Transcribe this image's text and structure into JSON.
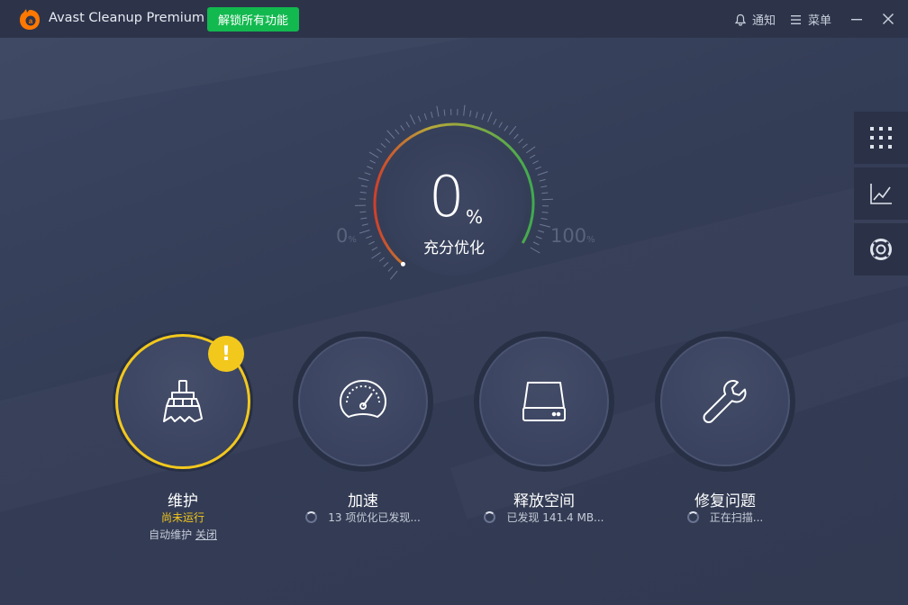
{
  "titlebar": {
    "app_name": "Avast Cleanup Premium",
    "unlock_label": "解锁所有功能",
    "notify_label": "通知",
    "menu_label": "菜单"
  },
  "gauge": {
    "value": "0",
    "unit": "%",
    "caption": "充分优化",
    "min_label": "0",
    "max_label": "100",
    "scale_unit": "%"
  },
  "features": [
    {
      "title": "维护",
      "status": "尚未运行",
      "sub_text": "自动维护",
      "sub_link": "关闭",
      "warn_symbol": "!"
    },
    {
      "title": "加速",
      "status": "13 项优化已发现..."
    },
    {
      "title": "释放空间",
      "status": "已发现 141.4 MB..."
    },
    {
      "title": "修复问题",
      "status": "正在扫描..."
    }
  ],
  "colors": {
    "accent_green": "#12b94f",
    "warning_yellow": "#f2c81d",
    "background": "#363f57",
    "titlebar": "#2d344a"
  },
  "icons": {
    "logo": "avast-logo-icon",
    "notify": "bell-icon",
    "menu": "hamburger-icon",
    "minimize": "minimize-icon",
    "close": "close-icon",
    "side": [
      "grid-icon",
      "chart-icon",
      "lifebuoy-icon"
    ],
    "features": [
      "broom-icon",
      "speedometer-icon",
      "hard-drive-icon",
      "wrench-icon"
    ]
  }
}
